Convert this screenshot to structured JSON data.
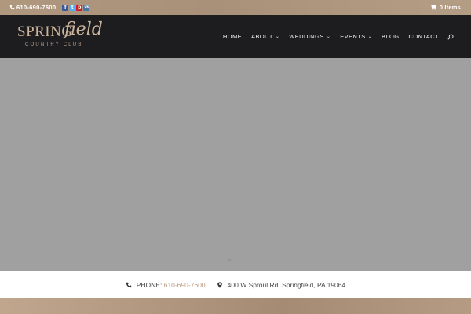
{
  "topbar": {
    "phone": "610-690-7600",
    "social": [
      {
        "name": "facebook",
        "glyph": "f",
        "color": "#3b5998"
      },
      {
        "name": "twitter",
        "glyph": "t",
        "color": "#55acee"
      },
      {
        "name": "pinterest",
        "glyph": "p",
        "color": "#cb2027"
      },
      {
        "name": "vk",
        "glyph": "vk",
        "color": "#4c75a3"
      }
    ],
    "cart": "0 Items"
  },
  "header": {
    "logo": {
      "brand": "SPRING",
      "brand_script": "field",
      "sub": "COUNTRY CLUB"
    },
    "nav": [
      {
        "label": "HOME",
        "has_dropdown": false
      },
      {
        "label": "ABOUT",
        "has_dropdown": true
      },
      {
        "label": "WEDDINGS",
        "has_dropdown": true
      },
      {
        "label": "EVENTS",
        "has_dropdown": true
      },
      {
        "label": "BLOG",
        "has_dropdown": false
      },
      {
        "label": "CONTACT",
        "has_dropdown": false
      }
    ]
  },
  "contact": {
    "phone_label": "PHONE:",
    "phone_value": "610-690-7600",
    "address": "400 W Sproul Rd, Springfield, PA 19064"
  },
  "colors": {
    "accent": "#b9997f",
    "header_bg": "#1d1d1f",
    "hero_bg": "#9fa09f"
  }
}
